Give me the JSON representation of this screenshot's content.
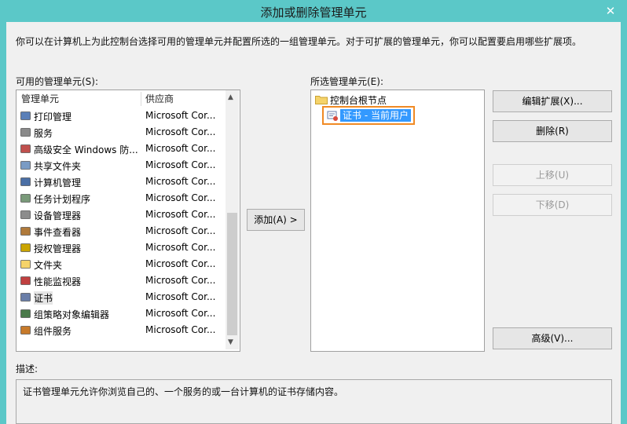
{
  "window": {
    "title": "添加或删除管理单元",
    "close_glyph": "✕"
  },
  "intro_text": "你可以在计算机上为此控制台选择可用的管理单元并配置所选的一组管理单元。对于可扩展的管理单元，你可以配置要启用哪些扩展项。",
  "available": {
    "label": "可用的管理单元(S):",
    "col_name": "管理单元",
    "col_vendor": "供应商",
    "items": [
      {
        "name": "打印管理",
        "vendor": "Microsoft Cor..."
      },
      {
        "name": "服务",
        "vendor": "Microsoft Cor..."
      },
      {
        "name": "高级安全 Windows 防...",
        "vendor": "Microsoft Cor..."
      },
      {
        "name": "共享文件夹",
        "vendor": "Microsoft Cor..."
      },
      {
        "name": "计算机管理",
        "vendor": "Microsoft Cor..."
      },
      {
        "name": "任务计划程序",
        "vendor": "Microsoft Cor..."
      },
      {
        "name": "设备管理器",
        "vendor": "Microsoft Cor..."
      },
      {
        "name": "事件查看器",
        "vendor": "Microsoft Cor..."
      },
      {
        "name": "授权管理器",
        "vendor": "Microsoft Cor..."
      },
      {
        "name": "文件夹",
        "vendor": "Microsoft Cor..."
      },
      {
        "name": "性能监视器",
        "vendor": "Microsoft Cor..."
      },
      {
        "name": "证书",
        "vendor": "Microsoft Cor..."
      },
      {
        "name": "组策略对象编辑器",
        "vendor": "Microsoft Cor..."
      },
      {
        "name": "组件服务",
        "vendor": "Microsoft Cor..."
      }
    ]
  },
  "add_button": "添加(A) >",
  "selected": {
    "label": "所选管理单元(E):",
    "root": "控制台根节点",
    "child": "证书 - 当前用户"
  },
  "buttons": {
    "edit_ext": "编辑扩展(X)...",
    "remove": "删除(R)",
    "move_up": "上移(U)",
    "move_down": "下移(D)",
    "advanced": "高级(V)..."
  },
  "description": {
    "label": "描述:",
    "text": "证书管理单元允许你浏览自己的、一个服务的或一台计算机的证书存储内容。"
  },
  "colors": {
    "accent": "#5bc8c8",
    "highlight": "#3399ff",
    "focus_ring": "#f08a24"
  }
}
